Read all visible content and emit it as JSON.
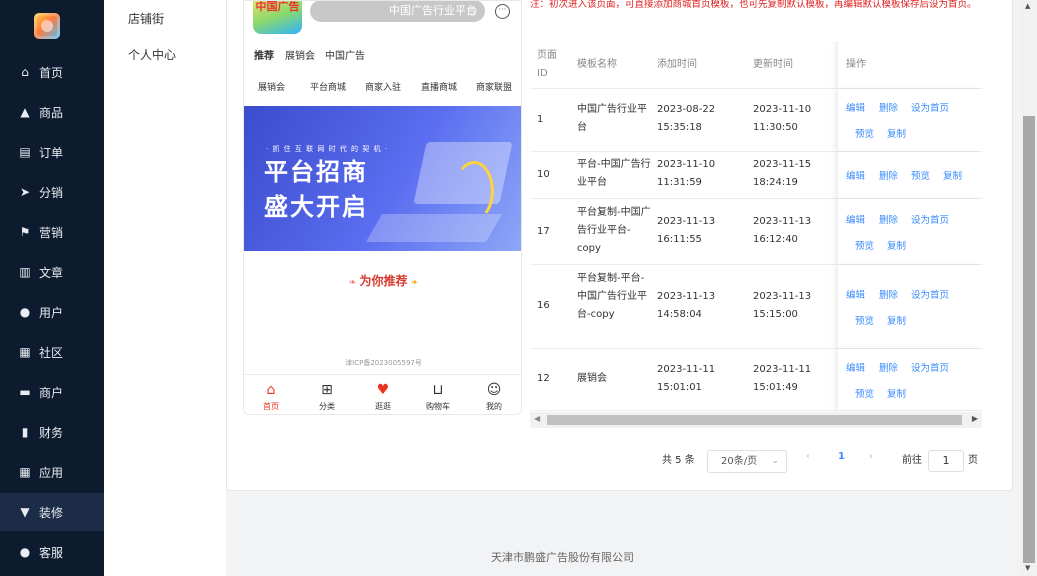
{
  "sidebar": {
    "items": [
      {
        "label": "首页",
        "icon": "home-icon"
      },
      {
        "label": "商品",
        "icon": "bag-icon"
      },
      {
        "label": "订单",
        "icon": "clipboard-icon"
      },
      {
        "label": "分销",
        "icon": "send-icon"
      },
      {
        "label": "营销",
        "icon": "flag-icon"
      },
      {
        "label": "文章",
        "icon": "article-icon"
      },
      {
        "label": "用户",
        "icon": "user-icon"
      },
      {
        "label": "社区",
        "icon": "community-icon"
      },
      {
        "label": "商户",
        "icon": "store-icon"
      },
      {
        "label": "财务",
        "icon": "bar-chart-icon"
      },
      {
        "label": "应用",
        "icon": "grid-icon"
      },
      {
        "label": "装修",
        "icon": "brush-icon"
      },
      {
        "label": "客服",
        "icon": "headset-icon"
      }
    ],
    "active": "装修"
  },
  "submenu": {
    "items": [
      "店铺街",
      "个人中心"
    ]
  },
  "preview": {
    "logo_text": "中国广告",
    "search_placeholder": "中国广告行业平台",
    "tabs": [
      "推荐",
      "展销会",
      "中国广告"
    ],
    "nav": [
      "展销会",
      "平台商城",
      "商家入驻",
      "直播商城",
      "商家联盟"
    ],
    "banner": {
      "tagline": "· 抓 住 互 联 网 时 代 的 契 机 ·",
      "line1": "平台招商",
      "line2": "盛大开启"
    },
    "recommend": "为你推荐",
    "icp": "津ICP备2023005597号",
    "bottom_nav": [
      "首页",
      "分类",
      "逛逛",
      "购物车",
      "我的"
    ]
  },
  "note": "注：初次进入该页面，可直接添加商城首页模板，也可先复制默认模板，再编辑默认模板保存后设为首页。",
  "table": {
    "headers": [
      "页面ID",
      "模板名称",
      "添加时间",
      "更新时间",
      "操作"
    ],
    "rows": [
      {
        "id": "1",
        "name": "中国广告行业平台",
        "added": "2023-08-22 15:35:18",
        "updated": "2023-11-10 11:30:50",
        "actions": [
          "编辑",
          "删除",
          "设为首页",
          "预览",
          "复制"
        ]
      },
      {
        "id": "10",
        "name": "平台-中国广告行业平台",
        "added": "2023-11-10 11:31:59",
        "updated": "2023-11-15 18:24:19",
        "actions": [
          "编辑",
          "删除",
          "预览",
          "复制"
        ]
      },
      {
        "id": "17",
        "name": "平台复制-中国广告行业平台-copy",
        "added": "2023-11-13 16:11:55",
        "updated": "2023-11-13 16:12:40",
        "actions": [
          "编辑",
          "删除",
          "设为首页",
          "预览",
          "复制"
        ]
      },
      {
        "id": "16",
        "name": "平台复制-平台-中国广告行业平台-copy",
        "added": "2023-11-13 14:58:04",
        "updated": "2023-11-13 15:15:00",
        "actions": [
          "编辑",
          "删除",
          "设为首页",
          "预览",
          "复制"
        ]
      },
      {
        "id": "12",
        "name": "展销会",
        "added": "2023-11-11 15:01:01",
        "updated": "2023-11-11 15:01:49",
        "actions": [
          "编辑",
          "删除",
          "设为首页",
          "预览",
          "复制"
        ]
      }
    ]
  },
  "pagination": {
    "total": "共 5 条",
    "page_size": "20条/页",
    "current": "1",
    "goto_label": "前往",
    "goto_value": "1",
    "page_unit": "页"
  },
  "footer": "天津市鹏盛广告股份有限公司",
  "colors": {
    "sidebar_bg": "#0d1b2e",
    "link": "#3b8cff",
    "note": "#e02020"
  }
}
